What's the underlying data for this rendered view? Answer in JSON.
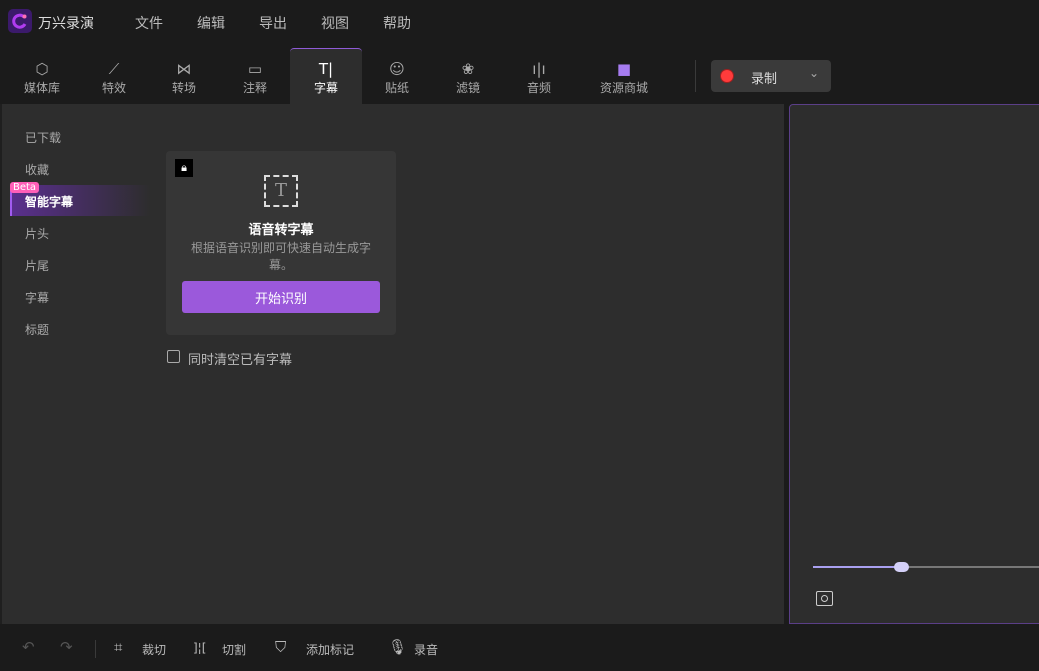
{
  "app": {
    "title": "万兴录演"
  },
  "menu": [
    "文件",
    "编辑",
    "导出",
    "视图",
    "帮助"
  ],
  "tabs": [
    {
      "label": "媒体库",
      "icon": "cube-icon"
    },
    {
      "label": "特效",
      "icon": "magic-wand-icon"
    },
    {
      "label": "转场",
      "icon": "transition-icon"
    },
    {
      "label": "注释",
      "icon": "comment-icon"
    },
    {
      "label": "字幕",
      "icon": "text-icon",
      "active": true
    },
    {
      "label": "贴纸",
      "icon": "smiley-icon"
    },
    {
      "label": "滤镜",
      "icon": "filter-icon"
    },
    {
      "label": "音频",
      "icon": "audio-wave-icon"
    },
    {
      "label": "资源商城",
      "icon": "store-icon"
    }
  ],
  "record": {
    "label": "录制",
    "color": "#ff3b3b"
  },
  "sidebar": {
    "items": [
      "已下载",
      "收藏",
      "智能字幕",
      "片头",
      "片尾",
      "字幕",
      "标题"
    ],
    "active": "智能字幕",
    "badge": "Beta"
  },
  "card": {
    "title": "语音转字幕",
    "desc": "根据语音识别即可快速自动生成字幕。",
    "button": "开始识别"
  },
  "checkbox": {
    "label": "同时清空已有字幕",
    "checked": false
  },
  "preview": {
    "slider_percent": 39
  },
  "bottom": {
    "crop": "裁切",
    "split": "切割",
    "marker": "添加标记",
    "voice": "录音"
  },
  "colors": {
    "accent": "#9b59db",
    "beta": "#ff5fb8"
  }
}
